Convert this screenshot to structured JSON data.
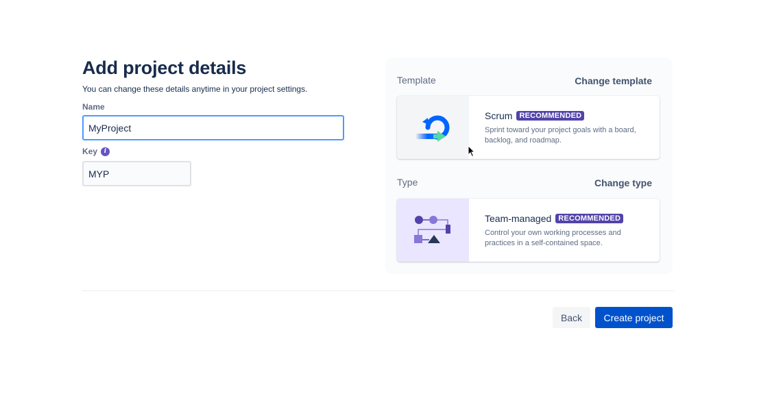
{
  "header": {
    "title": "Add project details",
    "subtitle": "You can change these details anytime in your project settings."
  },
  "form": {
    "name_label": "Name",
    "name_value": "MyProject",
    "key_label": "Key",
    "key_info_icon": "info-icon",
    "key_value": "MYP"
  },
  "template_section": {
    "label": "Template",
    "change_label": "Change template",
    "card": {
      "title": "Scrum",
      "badge": "RECOMMENDED",
      "description": "Sprint toward your project goals with a board, backlog, and roadmap.",
      "icon": "scrum-cycle-icon"
    }
  },
  "type_section": {
    "label": "Type",
    "change_label": "Change type",
    "card": {
      "title": "Team-managed",
      "badge": "RECOMMENDED",
      "description": "Control your own working processes and practices in a self-contained space.",
      "icon": "workflow-icon"
    }
  },
  "footer": {
    "back_label": "Back",
    "create_label": "Create project"
  },
  "colors": {
    "primary": "#0052cc",
    "badge": "#5243aa",
    "focus_border": "#4c9aff",
    "title": "#172b4d"
  }
}
